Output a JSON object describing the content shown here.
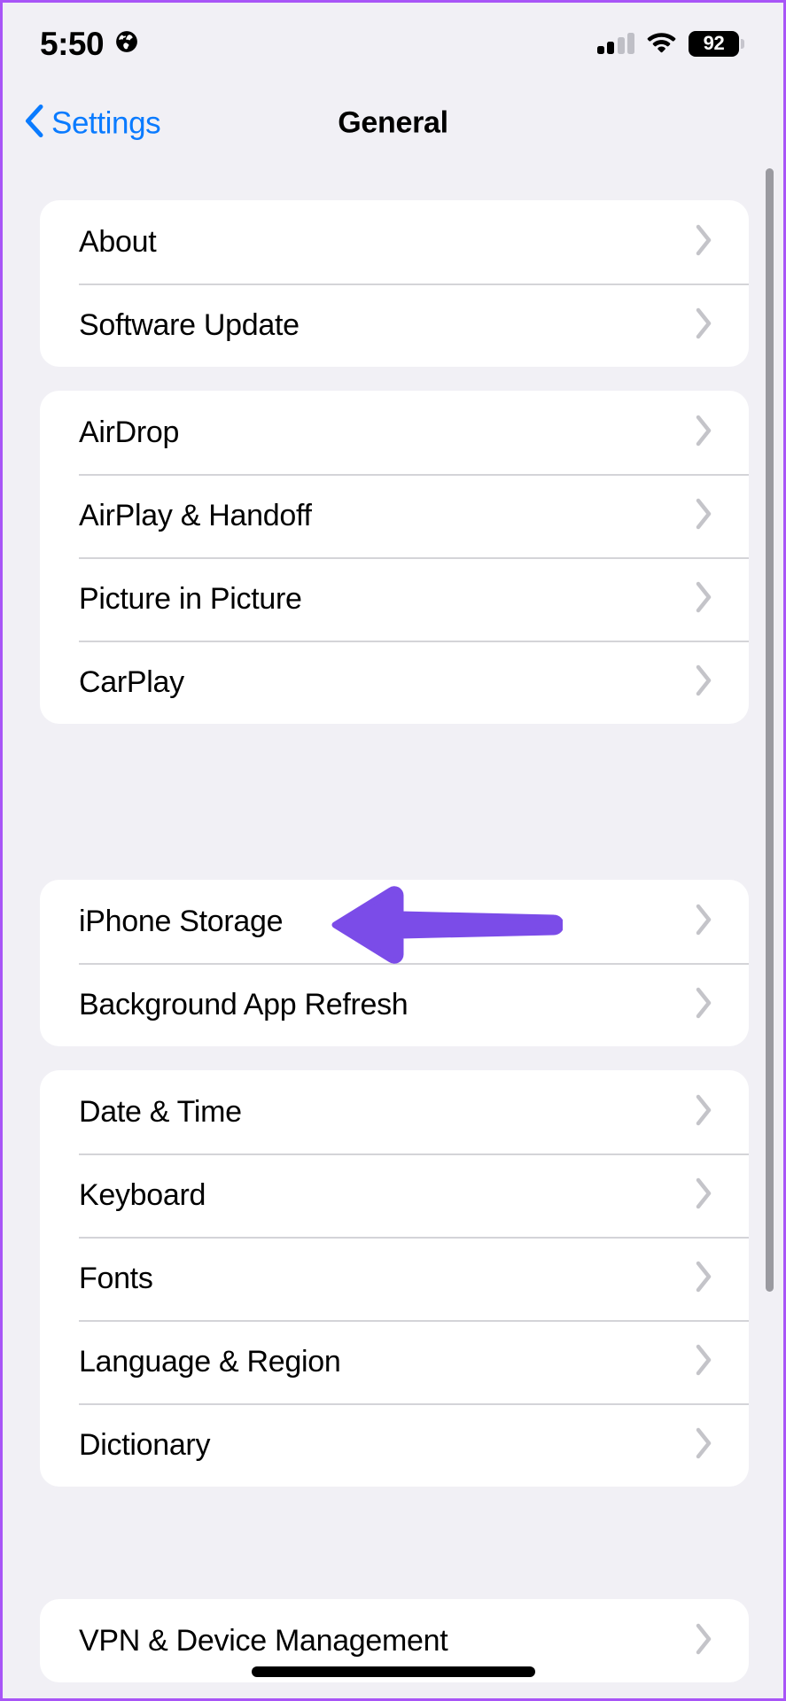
{
  "status_bar": {
    "time": "5:50",
    "location_icon": "globe-icon",
    "cellular_icon": "cellular-bars-icon",
    "wifi_icon": "wifi-icon",
    "battery_level": "92"
  },
  "nav_bar": {
    "back_label": "Settings",
    "back_icon": "chevron-left-icon",
    "title": "General"
  },
  "colors": {
    "background": "#F1F0F5",
    "card": "#FFFFFF",
    "accent_blue": "#0A7BFF",
    "annotation_purple": "#7B4CE8",
    "frame_purple": "#A855F7",
    "separator": "#D4D4D8",
    "chevron": "#C4C4C9",
    "scrollbar": "#9A9AA0"
  },
  "sections": [
    {
      "name": "device-info-section",
      "rows": [
        {
          "label": "About",
          "chevron": "chevron-right-icon"
        },
        {
          "label": "Software Update",
          "chevron": "chevron-right-icon"
        }
      ]
    },
    {
      "name": "connectivity-section",
      "rows": [
        {
          "label": "AirDrop",
          "chevron": "chevron-right-icon"
        },
        {
          "label": "AirPlay & Handoff",
          "chevron": "chevron-right-icon"
        },
        {
          "label": "Picture in Picture",
          "chevron": "chevron-right-icon"
        },
        {
          "label": "CarPlay",
          "chevron": "chevron-right-icon"
        }
      ]
    },
    {
      "name": "storage-section",
      "rows": [
        {
          "label": "iPhone Storage",
          "chevron": "chevron-right-icon"
        },
        {
          "label": "Background App Refresh",
          "chevron": "chevron-right-icon"
        }
      ]
    },
    {
      "name": "localization-section",
      "rows": [
        {
          "label": "Date & Time",
          "chevron": "chevron-right-icon"
        },
        {
          "label": "Keyboard",
          "chevron": "chevron-right-icon"
        },
        {
          "label": "Fonts",
          "chevron": "chevron-right-icon"
        },
        {
          "label": "Language & Region",
          "chevron": "chevron-right-icon"
        },
        {
          "label": "Dictionary",
          "chevron": "chevron-right-icon"
        }
      ]
    },
    {
      "name": "management-section",
      "rows": [
        {
          "label": "VPN & Device Management",
          "chevron": "chevron-right-icon"
        }
      ]
    }
  ],
  "annotation": {
    "type": "arrow-left",
    "target": "iPhone Storage",
    "color": "#7B4CE8"
  }
}
